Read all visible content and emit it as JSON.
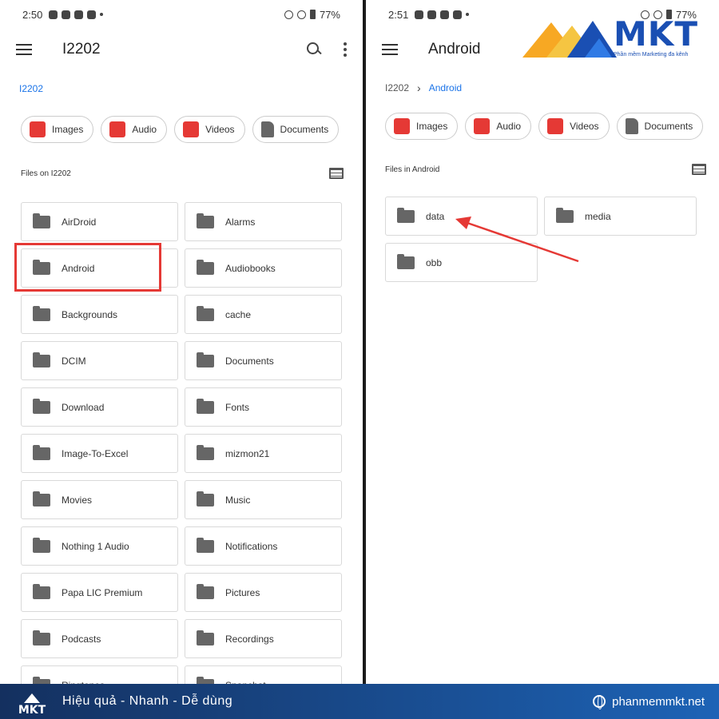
{
  "left": {
    "status": {
      "time": "2:50",
      "battery": "77%"
    },
    "appbar_title": "I2202",
    "breadcrumb": {
      "current": "I2202"
    },
    "chips": [
      {
        "label": "Images"
      },
      {
        "label": "Audio"
      },
      {
        "label": "Videos"
      },
      {
        "label": "Documents"
      }
    ],
    "section_label": "Files on I2202",
    "folders": [
      "AirDroid",
      "Alarms",
      "Android",
      "Audiobooks",
      "Backgrounds",
      "cache",
      "DCIM",
      "Documents",
      "Download",
      "Fonts",
      "Image-To-Excel",
      "mizmon21",
      "Movies",
      "Music",
      "Nothing 1 Audio",
      "Notifications",
      "Papa LIC Premium",
      "Pictures",
      "Podcasts",
      "Recordings",
      "Ringtones",
      "Snapchat"
    ]
  },
  "right": {
    "status": {
      "time": "2:51",
      "battery": "77%"
    },
    "appbar_title": "Android",
    "breadcrumb": {
      "root": "I2202",
      "current": "Android"
    },
    "chips": [
      {
        "label": "Images"
      },
      {
        "label": "Audio"
      },
      {
        "label": "Videos"
      },
      {
        "label": "Documents"
      }
    ],
    "section_label": "Files in Android",
    "folders": [
      "data",
      "media",
      "obb"
    ]
  },
  "watermark": {
    "brand": "MKT",
    "tagline": "Phần mềm Marketing đa kênh"
  },
  "footer": {
    "mini_logo": "MKT",
    "slogan": "Hiệu quả - Nhanh  - Dễ dùng",
    "website": "phanmemmkt.net"
  },
  "colors": {
    "accent_blue": "#1a73e8",
    "chip_red": "#e53935",
    "highlight_red": "#e53935",
    "brand_blue": "#1a4fb3",
    "footer_start": "#14305f",
    "footer_end": "#1d63b6"
  }
}
